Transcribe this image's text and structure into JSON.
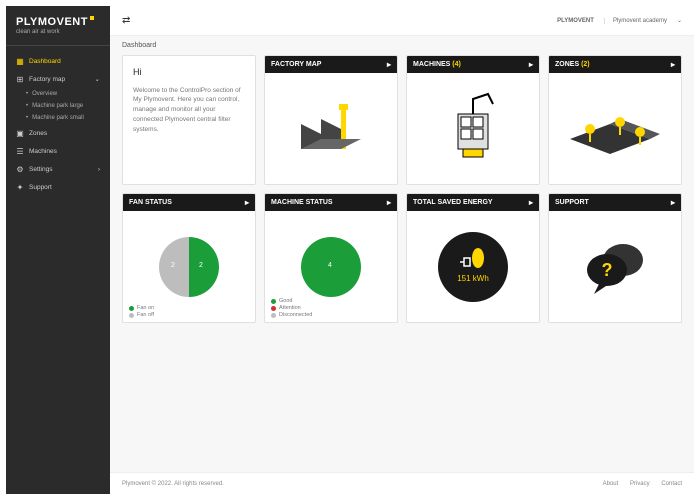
{
  "brand": {
    "name": "PLYMOVENT",
    "tagline": "clean air at work",
    "academy": "Plymovent academy"
  },
  "nav": {
    "dashboard": "Dashboard",
    "factoryMap": "Factory map",
    "overview": "Overview",
    "parkLarge": "Machine park large",
    "parkSmall": "Machine park small",
    "zones": "Zones",
    "machines": "Machines",
    "settings": "Settings",
    "support": "Support"
  },
  "crumb": "Dashboard",
  "intro": {
    "title": "Hi",
    "body": "Welcome to the ControlPro section of My Plymovent. Here you can control, manage and monitor all your connected Plymovent central filter systems."
  },
  "cards": {
    "factoryMap": "FACTORY MAP",
    "machines": {
      "label": "MACHINES",
      "count": "(4)"
    },
    "zones": {
      "label": "ZONES",
      "count": "(2)"
    },
    "fanStatus": "FAN STATUS",
    "machineStatus": "MACHINE STATUS",
    "energy": "TOTAL SAVED ENERGY",
    "support": "SUPPORT"
  },
  "chart_data": [
    {
      "type": "pie",
      "title": "FAN STATUS",
      "series": [
        {
          "name": "Fan on",
          "value": 2,
          "color": "#1b9e3a"
        },
        {
          "name": "Fan off",
          "value": 2,
          "color": "#bdbdbd"
        }
      ]
    },
    {
      "type": "pie",
      "title": "MACHINE STATUS",
      "series": [
        {
          "name": "Good",
          "value": 4,
          "color": "#1b9e3a"
        },
        {
          "name": "Attention",
          "value": 0,
          "color": "#d32f2f"
        },
        {
          "name": "Disconnected",
          "value": 0,
          "color": "#bdbdbd"
        }
      ]
    }
  ],
  "fanLegend": {
    "on": "Fan on",
    "off": "Fan off"
  },
  "machineLegend": {
    "good": "Good",
    "attention": "Attention",
    "disconnected": "Disconnected"
  },
  "energy": {
    "value": "151",
    "unit": "kWh"
  },
  "footer": {
    "copy": "Plymovent © 2022. All rights reserved.",
    "about": "About",
    "privacy": "Privacy",
    "contact": "Contact"
  }
}
